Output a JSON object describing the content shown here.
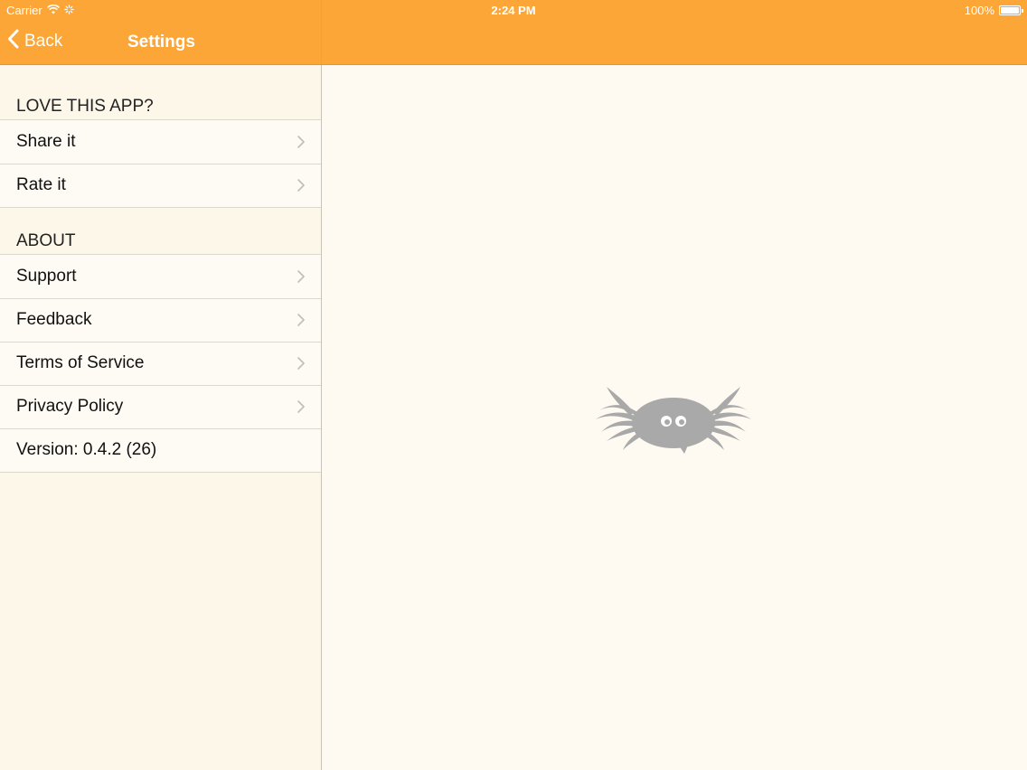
{
  "status_bar": {
    "carrier": "Carrier",
    "time": "2:24 PM",
    "battery_text": "100%",
    "battery_level": 1.0
  },
  "nav": {
    "back_label": "Back",
    "title": "Settings"
  },
  "sections": [
    {
      "header": "LOVE THIS APP?",
      "items": [
        {
          "label": "Share it"
        },
        {
          "label": "Rate it"
        }
      ]
    },
    {
      "header": "ABOUT",
      "items": [
        {
          "label": "Support"
        },
        {
          "label": "Feedback"
        },
        {
          "label": "Terms of Service"
        },
        {
          "label": "Privacy Policy"
        }
      ],
      "version": "Version: 0.4.2 (26)"
    }
  ],
  "colors": {
    "accent": "#fba636",
    "background": "#fdf8ee",
    "mascot": "#a9a9a9"
  },
  "icons": {
    "wifi": "wifi-icon",
    "activity": "activity-spinner-icon",
    "battery": "battery-icon",
    "back": "chevron-left-icon",
    "disclosure": "chevron-right-icon",
    "mascot": "mascot-logo-icon"
  }
}
